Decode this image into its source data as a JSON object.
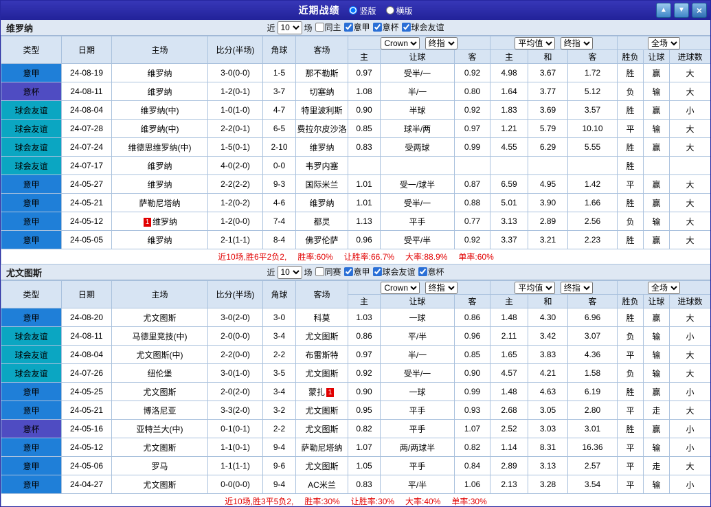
{
  "titlebar": {
    "title": "近期战绩",
    "layout_options": [
      {
        "label": "竖版",
        "selected": true
      },
      {
        "label": "横版",
        "selected": false
      }
    ],
    "buttons": {
      "up": "▲",
      "down": "▼",
      "close": "×"
    }
  },
  "colors": {
    "titlebar_bg": "#2a2aa0",
    "win_red": "#e10000",
    "loss_blue": "#0000cd",
    "draw_green": "#008000",
    "header_bg": "#d7e4f3"
  },
  "league_colors": {
    "意甲": "#1f7fd8",
    "意杯": "#4f4cc2",
    "球会友谊": "#0ba6c2"
  },
  "table_header": {
    "type": "类型",
    "date": "日期",
    "home": "主场",
    "score": "比分(半场)",
    "corner": "角球",
    "away": "客场",
    "odds_sub": [
      "主",
      "让球",
      "客"
    ],
    "avg_sub": [
      "主",
      "和",
      "客"
    ],
    "result_sub": [
      "胜负",
      "让球",
      "进球数"
    ]
  },
  "sections": [
    {
      "team": "维罗纳",
      "filter": {
        "near": "近",
        "count": "10",
        "games": "场",
        "checkboxes": [
          {
            "label": "同主",
            "checked": false
          },
          {
            "label": "意甲",
            "checked": true
          },
          {
            "label": "意杯",
            "checked": true
          },
          {
            "label": "球会友谊",
            "checked": true
          }
        ]
      },
      "selects": {
        "bookmaker": "Crown",
        "final_a": "终指",
        "average": "平均值",
        "final_b": "终指",
        "scope": "全场"
      },
      "rows": [
        {
          "league": "意甲",
          "date": "24-08-19",
          "home": {
            "name": "维罗纳",
            "color": "red"
          },
          "score": [
            "3-0(0-0)",
            "red"
          ],
          "corner": "1-5",
          "away": {
            "name": "那不勒斯",
            "color": "black"
          },
          "odds": [
            "0.97",
            "受半/一",
            "0.92",
            "4.98",
            "3.67",
            "1.72"
          ],
          "results": [
            [
              "胜",
              "red"
            ],
            [
              "赢",
              "red"
            ],
            [
              "大",
              "red"
            ]
          ]
        },
        {
          "league": "意杯",
          "date": "24-08-11",
          "home": {
            "name": "维罗纳",
            "color": "red"
          },
          "score": [
            "1-2(0-1)",
            "red"
          ],
          "corner": "3-7",
          "away": {
            "name": "切塞纳",
            "color": "black"
          },
          "odds": [
            "1.08",
            "半/一",
            "0.80",
            "1.64",
            "3.77",
            "5.12"
          ],
          "results": [
            [
              "负",
              "blue"
            ],
            [
              "输",
              "blue"
            ],
            [
              "大",
              "red"
            ]
          ]
        },
        {
          "league": "球会友谊",
          "date": "24-08-04",
          "home": {
            "name": "维罗纳(中)",
            "color": "red"
          },
          "score": [
            "1-0(1-0)",
            "red"
          ],
          "corner": "4-7",
          "away": {
            "name": "特里波利斯",
            "color": "black"
          },
          "odds": [
            "0.90",
            "半球",
            "0.92",
            "1.83",
            "3.69",
            "3.57"
          ],
          "results": [
            [
              "胜",
              "red"
            ],
            [
              "赢",
              "red"
            ],
            [
              "小",
              "blue"
            ]
          ]
        },
        {
          "league": "球会友谊",
          "date": "24-07-28",
          "home": {
            "name": "维罗纳(中)",
            "color": "red"
          },
          "score": [
            "2-2(0-1)",
            "red"
          ],
          "corner": "6-5",
          "away": {
            "name": "费拉尔皮沙洛",
            "color": "black"
          },
          "odds": [
            "0.85",
            "球半/两",
            "0.97",
            "1.21",
            "5.79",
            "10.10"
          ],
          "results": [
            [
              "平",
              "green"
            ],
            [
              "输",
              "blue"
            ],
            [
              "大",
              "red"
            ]
          ]
        },
        {
          "league": "球会友谊",
          "date": "24-07-24",
          "home": {
            "name": "维德思维罗纳(中)",
            "color": "black"
          },
          "score": [
            "1-5(0-1)",
            "red"
          ],
          "corner": "2-10",
          "away": {
            "name": "维罗纳",
            "color": "green"
          },
          "odds": [
            "0.83",
            "受两球",
            "0.99",
            "4.55",
            "6.29",
            "5.55"
          ],
          "results": [
            [
              "胜",
              "red"
            ],
            [
              "赢",
              "red"
            ],
            [
              "大",
              "red"
            ]
          ]
        },
        {
          "league": "球会友谊",
          "date": "24-07-17",
          "home": {
            "name": "维罗纳",
            "color": "red"
          },
          "score": [
            "4-0(2-0)",
            "red"
          ],
          "corner": "0-0",
          "away": {
            "name": "韦罗内塞",
            "color": "black"
          },
          "odds": [
            "",
            "",
            "",
            "",
            "",
            ""
          ],
          "results": [
            [
              "胜",
              "red"
            ],
            [
              "",
              ""
            ],
            [
              "",
              ""
            ]
          ]
        },
        {
          "league": "意甲",
          "date": "24-05-27",
          "home": {
            "name": "维罗纳",
            "color": "red"
          },
          "score": [
            "2-2(2-2)",
            "red"
          ],
          "corner": "9-3",
          "away": {
            "name": "国际米兰",
            "color": "black"
          },
          "odds": [
            "1.01",
            "受一/球半",
            "0.87",
            "6.59",
            "4.95",
            "1.42"
          ],
          "results": [
            [
              "平",
              "green"
            ],
            [
              "赢",
              "red"
            ],
            [
              "大",
              "red"
            ]
          ]
        },
        {
          "league": "意甲",
          "date": "24-05-21",
          "home": {
            "name": "萨勒尼塔纳",
            "color": "black"
          },
          "score": [
            "1-2(0-2)",
            "red"
          ],
          "corner": "4-6",
          "away": {
            "name": "维罗纳",
            "color": "green"
          },
          "odds": [
            "1.01",
            "受半/一",
            "0.88",
            "5.01",
            "3.90",
            "1.66"
          ],
          "results": [
            [
              "胜",
              "red"
            ],
            [
              "赢",
              "red"
            ],
            [
              "大",
              "red"
            ]
          ]
        },
        {
          "league": "意甲",
          "date": "24-05-12",
          "home": {
            "name": "维罗纳",
            "color": "red",
            "redcard": "1"
          },
          "score": [
            "1-2(0-0)",
            "red"
          ],
          "corner": "7-4",
          "away": {
            "name": "都灵",
            "color": "black"
          },
          "odds": [
            "1.13",
            "平手",
            "0.77",
            "3.13",
            "2.89",
            "2.56"
          ],
          "results": [
            [
              "负",
              "blue"
            ],
            [
              "输",
              "blue"
            ],
            [
              "大",
              "red"
            ]
          ]
        },
        {
          "league": "意甲",
          "date": "24-05-05",
          "home": {
            "name": "维罗纳",
            "color": "red"
          },
          "score": [
            "2-1(1-1)",
            "red"
          ],
          "corner": "8-4",
          "away": {
            "name": "佛罗伦萨",
            "color": "black"
          },
          "odds": [
            "0.96",
            "受平/半",
            "0.92",
            "3.37",
            "3.21",
            "2.23"
          ],
          "results": [
            [
              "胜",
              "red"
            ],
            [
              "赢",
              "red"
            ],
            [
              "大",
              "red"
            ]
          ]
        }
      ],
      "summary": {
        "prefix": "近10场,胜6平2负2,",
        "stats": [
          {
            "label": "胜率:",
            "value": "60%"
          },
          {
            "label": "让胜率:",
            "value": "66.7%"
          },
          {
            "label": "大率:",
            "value": "88.9%"
          },
          {
            "label": "单率:",
            "value": "60%"
          }
        ]
      }
    },
    {
      "team": "尤文图斯",
      "filter": {
        "near": "近",
        "count": "10",
        "games": "场",
        "checkboxes": [
          {
            "label": "同赛",
            "checked": false
          },
          {
            "label": "意甲",
            "checked": true
          },
          {
            "label": "球会友谊",
            "checked": true
          },
          {
            "label": "意杯",
            "checked": true
          }
        ]
      },
      "selects": {
        "bookmaker": "Crown",
        "final_a": "终指",
        "average": "平均值",
        "final_b": "终指",
        "scope": "全场"
      },
      "rows": [
        {
          "league": "意甲",
          "date": "24-08-20",
          "home": {
            "name": "尤文图斯",
            "color": "red"
          },
          "score": [
            "3-0(2-0)",
            "red"
          ],
          "corner": "3-0",
          "away": {
            "name": "科莫",
            "color": "black"
          },
          "odds": [
            "1.03",
            "一球",
            "0.86",
            "1.48",
            "4.30",
            "6.96"
          ],
          "results": [
            [
              "胜",
              "red"
            ],
            [
              "赢",
              "red"
            ],
            [
              "大",
              "red"
            ]
          ]
        },
        {
          "league": "球会友谊",
          "date": "24-08-11",
          "home": {
            "name": "马德里竞技(中)",
            "color": "red"
          },
          "score": [
            "2-0(0-0)",
            "red"
          ],
          "corner": "3-4",
          "away": {
            "name": "尤文图斯",
            "color": "green"
          },
          "odds": [
            "0.86",
            "平/半",
            "0.96",
            "2.11",
            "3.42",
            "3.07"
          ],
          "results": [
            [
              "负",
              "blue"
            ],
            [
              "输",
              "blue"
            ],
            [
              "小",
              "blue"
            ]
          ]
        },
        {
          "league": "球会友谊",
          "date": "24-08-04",
          "home": {
            "name": "尤文图斯(中)",
            "color": "green"
          },
          "score": [
            "2-2(0-0)",
            "red"
          ],
          "corner": "2-2",
          "away": {
            "name": "布雷斯特",
            "color": "black"
          },
          "odds": [
            "0.97",
            "半/一",
            "0.85",
            "1.65",
            "3.83",
            "4.36"
          ],
          "results": [
            [
              "平",
              "green"
            ],
            [
              "输",
              "blue"
            ],
            [
              "大",
              "red"
            ]
          ]
        },
        {
          "league": "球会友谊",
          "date": "24-07-26",
          "home": {
            "name": "纽伦堡",
            "color": "black"
          },
          "score": [
            "3-0(1-0)",
            "red"
          ],
          "corner": "3-5",
          "away": {
            "name": "尤文图斯",
            "color": "green"
          },
          "odds": [
            "0.92",
            "受半/一",
            "0.90",
            "4.57",
            "4.21",
            "1.58"
          ],
          "results": [
            [
              "负",
              "blue"
            ],
            [
              "输",
              "blue"
            ],
            [
              "大",
              "red"
            ]
          ]
        },
        {
          "league": "意甲",
          "date": "24-05-25",
          "home": {
            "name": "尤文图斯",
            "color": "red"
          },
          "score": [
            "2-0(2-0)",
            "red"
          ],
          "corner": "3-4",
          "away": {
            "name": "蒙扎",
            "color": "black",
            "redcard": "1"
          },
          "odds": [
            "0.90",
            "一球",
            "0.99",
            "1.48",
            "4.63",
            "6.19"
          ],
          "results": [
            [
              "胜",
              "red"
            ],
            [
              "赢",
              "red"
            ],
            [
              "小",
              "blue"
            ]
          ]
        },
        {
          "league": "意甲",
          "date": "24-05-21",
          "home": {
            "name": "博洛尼亚",
            "color": "black"
          },
          "score": [
            "3-3(2-0)",
            "red"
          ],
          "corner": "3-2",
          "away": {
            "name": "尤文图斯",
            "color": "green"
          },
          "odds": [
            "0.95",
            "平手",
            "0.93",
            "2.68",
            "3.05",
            "2.80"
          ],
          "results": [
            [
              "平",
              "green"
            ],
            [
              "走",
              "green"
            ],
            [
              "大",
              "red"
            ]
          ]
        },
        {
          "league": "意杯",
          "date": "24-05-16",
          "home": {
            "name": "亚特兰大(中)",
            "color": "black"
          },
          "score": [
            "0-1(0-1)",
            "red"
          ],
          "corner": "2-2",
          "away": {
            "name": "尤文图斯",
            "color": "green"
          },
          "odds": [
            "0.82",
            "平手",
            "1.07",
            "2.52",
            "3.03",
            "3.01"
          ],
          "results": [
            [
              "胜",
              "red"
            ],
            [
              "赢",
              "red"
            ],
            [
              "小",
              "blue"
            ]
          ]
        },
        {
          "league": "意甲",
          "date": "24-05-12",
          "home": {
            "name": "尤文图斯",
            "color": "red"
          },
          "score": [
            "1-1(0-1)",
            "red"
          ],
          "corner": "9-4",
          "away": {
            "name": "萨勒尼塔纳",
            "color": "black"
          },
          "odds": [
            "1.07",
            "两/两球半",
            "0.82",
            "1.14",
            "8.31",
            "16.36"
          ],
          "results": [
            [
              "平",
              "green"
            ],
            [
              "输",
              "blue"
            ],
            [
              "小",
              "blue"
            ]
          ]
        },
        {
          "league": "意甲",
          "date": "24-05-06",
          "home": {
            "name": "罗马",
            "color": "black"
          },
          "score": [
            "1-1(1-1)",
            "red"
          ],
          "corner": "9-6",
          "away": {
            "name": "尤文图斯",
            "color": "green"
          },
          "odds": [
            "1.05",
            "平手",
            "0.84",
            "2.89",
            "3.13",
            "2.57"
          ],
          "results": [
            [
              "平",
              "green"
            ],
            [
              "走",
              "green"
            ],
            [
              "大",
              "red"
            ]
          ]
        },
        {
          "league": "意甲",
          "date": "24-04-27",
          "home": {
            "name": "尤文图斯",
            "color": "red"
          },
          "score": [
            "0-0(0-0)",
            "blue"
          ],
          "corner": "9-4",
          "away": {
            "name": "AC米兰",
            "color": "black"
          },
          "odds": [
            "0.83",
            "平/半",
            "1.06",
            "2.13",
            "3.28",
            "3.54"
          ],
          "results": [
            [
              "平",
              "green"
            ],
            [
              "输",
              "blue"
            ],
            [
              "小",
              "blue"
            ]
          ]
        }
      ],
      "summary": {
        "prefix": "近10场,胜3平5负2,",
        "stats": [
          {
            "label": "胜率:",
            "value": "30%"
          },
          {
            "label": "让胜率:",
            "value": "30%"
          },
          {
            "label": "大率:",
            "value": "40%"
          },
          {
            "label": "单率:",
            "value": "30%"
          }
        ]
      }
    }
  ]
}
